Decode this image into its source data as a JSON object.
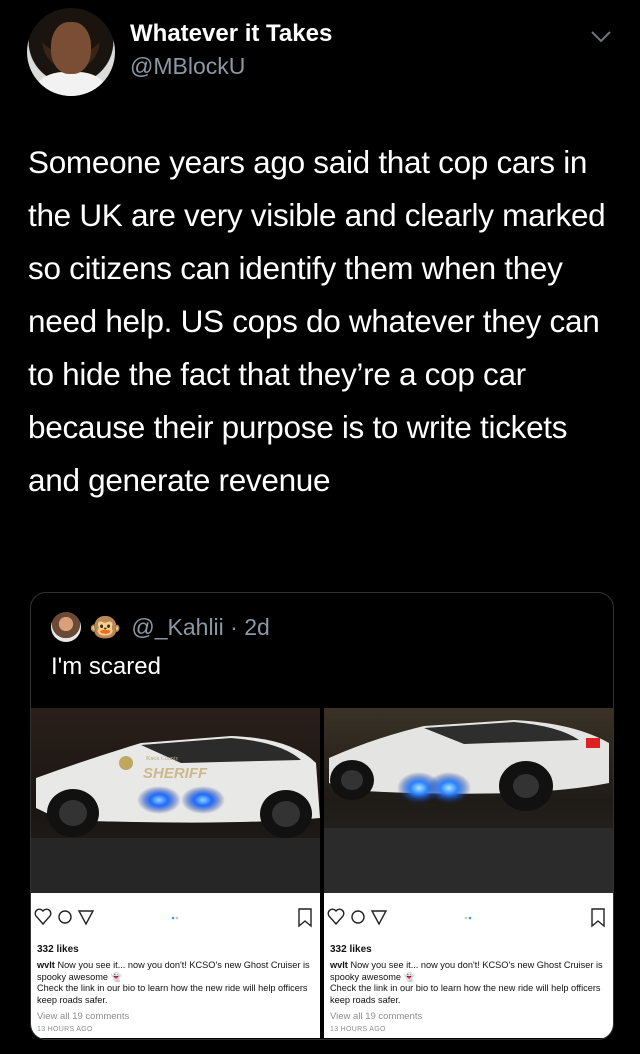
{
  "tweet": {
    "display_name": "Whatever it Takes",
    "handle": "@MBlockU",
    "text": "Someone years ago said that cop cars in the UK are very visible and clearly marked so citizens can identify them when they need help. US cops do whatever they can to hide the fact that they’re a cop car because their purpose is to write tickets and generate revenue",
    "menu_icon": "chevron-down-icon"
  },
  "quoted": {
    "handle": "@_Kahlii",
    "time": "· 2d",
    "emoji": "🐵",
    "text": "I'm scared"
  },
  "posts": [
    {
      "likes": "332 likes",
      "user": "wvlt",
      "caption": "Now you see it... now you don't! KCSO's new Ghost Cruiser is spooky awesome 👻",
      "caption2": "Check the link in our bio to learn how the new ride will help officers keep roads safer.",
      "view_all": "View all 19 comments",
      "time": "13 HOURS AGO",
      "door_text": "Knox County",
      "door_sheriff": "SHERIFF"
    },
    {
      "likes": "332 likes",
      "user": "wvlt",
      "caption": "Now you see it... now you don't! KCSO's new Ghost Cruiser is spooky awesome 👻",
      "caption2": "Check the link in our bio to learn how the new ride will help officers keep roads safer.",
      "view_all": "View all 19 comments",
      "time": "13 HOURS AGO"
    }
  ]
}
